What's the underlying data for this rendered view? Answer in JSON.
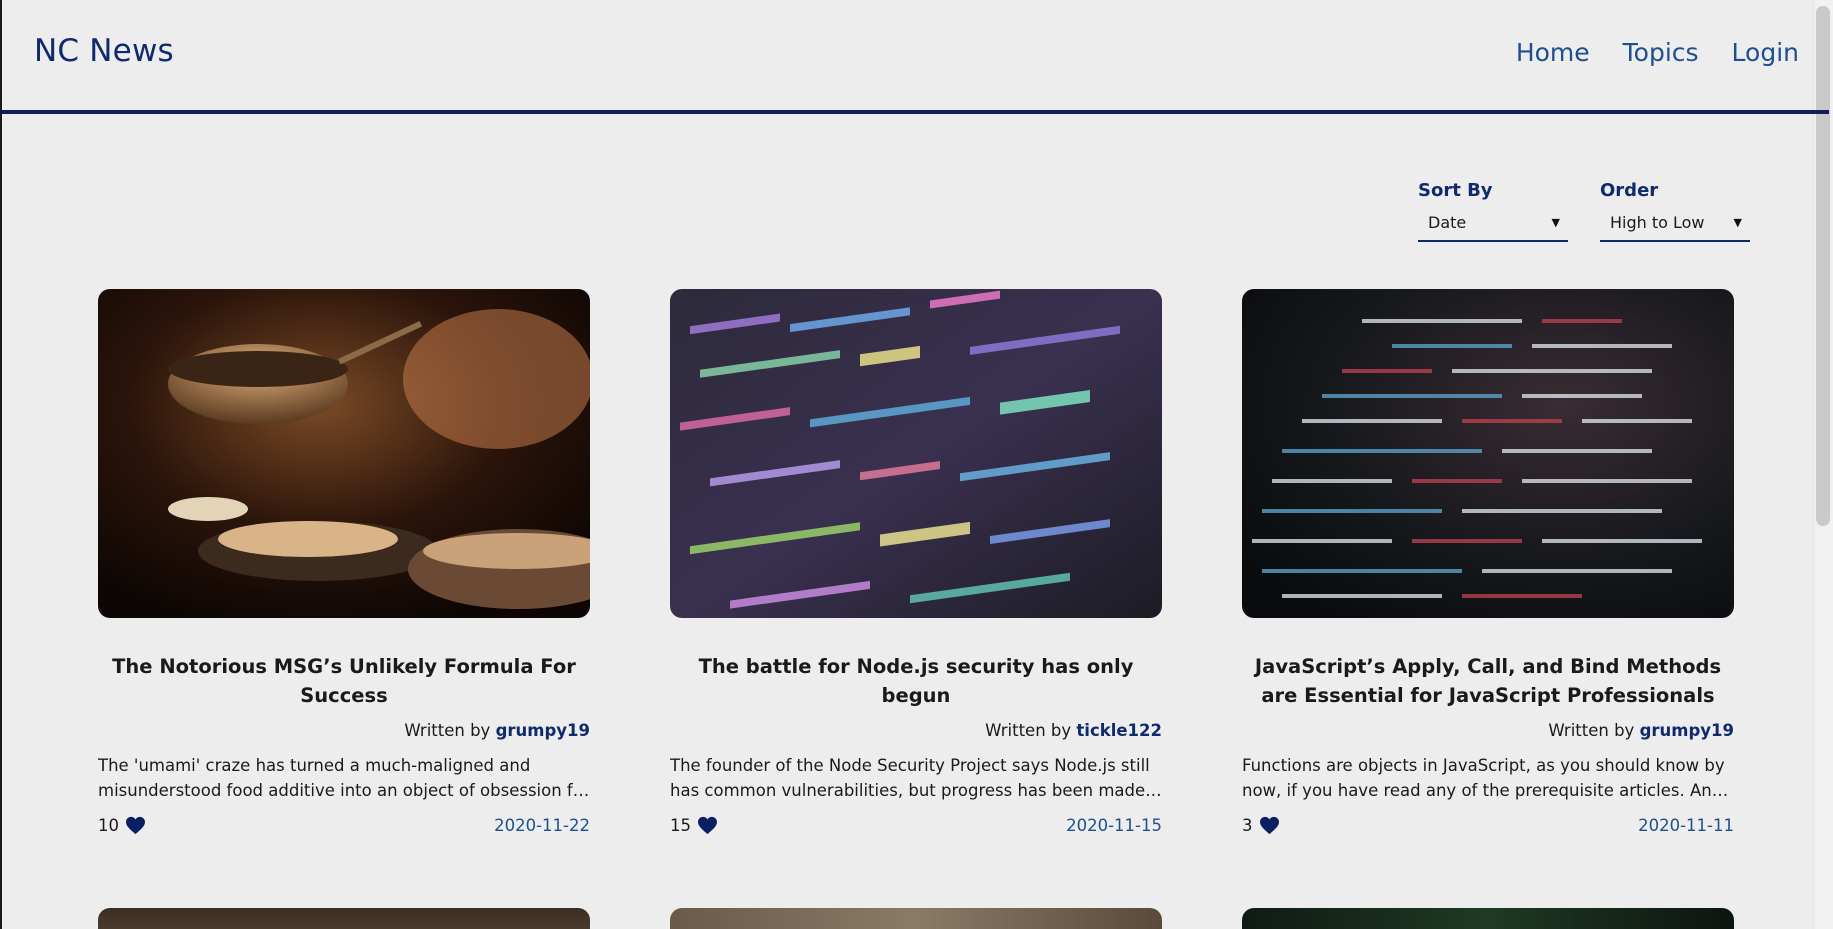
{
  "header": {
    "logo": "NC News",
    "nav": [
      "Home",
      "Topics",
      "Login"
    ]
  },
  "controls": {
    "sort_label": "Sort By",
    "sort_value": "Date",
    "order_label": "Order",
    "order_value": "High to Low"
  },
  "articles": [
    {
      "title": "The Notorious MSG’s Unlikely Formula For Success",
      "written_by": "Written by",
      "author": "grumpy19",
      "body": "The 'umami' craze has turned a much-maligned and misunderstood food additive into an object of obsession for the world’s most innovative chefs.",
      "votes": "10",
      "date": "2020-11-22",
      "image_icon": "food-photo"
    },
    {
      "title": "The battle for Node.js security has only begun",
      "written_by": "Written by",
      "author": "tickle122",
      "body": "The founder of the Node Security Project says Node.js still has common vulnerabilities, but progress has been made to make it more secure.",
      "votes": "15",
      "date": "2020-11-15",
      "image_icon": "code-screen-photo"
    },
    {
      "title": "JavaScript’s Apply, Call, and Bind Methods are Essential for JavaScript Professionals",
      "written_by": "Written by",
      "author": "grumpy19",
      "body": "Functions are objects in JavaScript, as you should know by now, if you have read any of the prerequisite articles. And as objects, functions have methods.",
      "votes": "3",
      "date": "2020-11-11",
      "image_icon": "code-screen-photo"
    }
  ],
  "colors": {
    "background": "#ededed",
    "brand": "#102a6e",
    "nav_link": "#1e4f8e",
    "heart": "#0b1f63"
  }
}
